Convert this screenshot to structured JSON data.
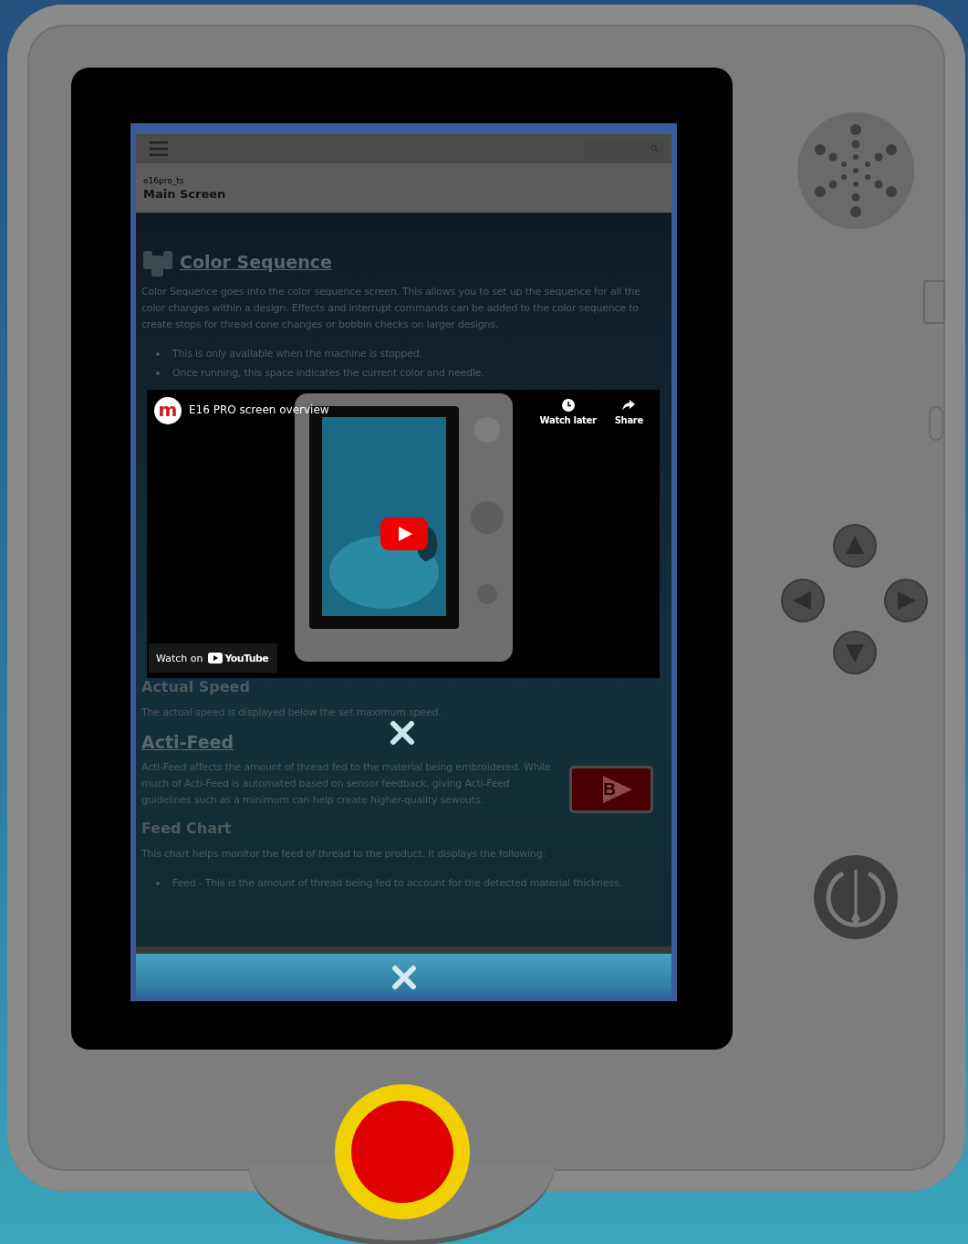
{
  "header": {
    "breadcrumb": "e16pro_ts",
    "title": "Main Screen"
  },
  "content": [
    {
      "kind": "icon_link_heading",
      "text": "Color Sequence"
    },
    {
      "kind": "paragraph",
      "text": "Color Sequence goes into the color sequence screen. This allows you to set up the sequence for all the color changes within a design. Effects and interrupt commands can be added to the color sequence to create stops for thread cone changes or bobbin checks on larger designs."
    },
    {
      "kind": "bullets",
      "items": [
        "This is only available when the machine is stopped.",
        "Once running, this space indicates the current color and needle."
      ]
    },
    {
      "kind": "video",
      "channel_initial": "m",
      "title": "E16 PRO screen overview",
      "actions": [
        "Watch later",
        "Share"
      ],
      "watch_on": "Watch on",
      "platform": "YouTube"
    },
    {
      "kind": "heading",
      "text": "Actual Speed"
    },
    {
      "kind": "paragraph",
      "text": "The actual speed is displayed below the set maximum speed."
    },
    {
      "kind": "link_heading",
      "text": "Acti-Feed"
    },
    {
      "kind": "paragraph",
      "text": "Acti-Feed affects the amount of thread fed to the material being embroidered. While much of Acti-Feed is automated based on sensor feedback, giving Acti-Feed guidelines such as a minimum can help create higher-quality sewouts.",
      "video_button": "B"
    },
    {
      "kind": "heading",
      "text": "Feed Chart"
    },
    {
      "kind": "paragraph",
      "text": "This chart helps monitor the feed of thread to the product. It displays the following:"
    },
    {
      "kind": "bullets",
      "items": [
        "Feed - This is the amount of thread being fed to account for the detected material thickness."
      ]
    }
  ]
}
